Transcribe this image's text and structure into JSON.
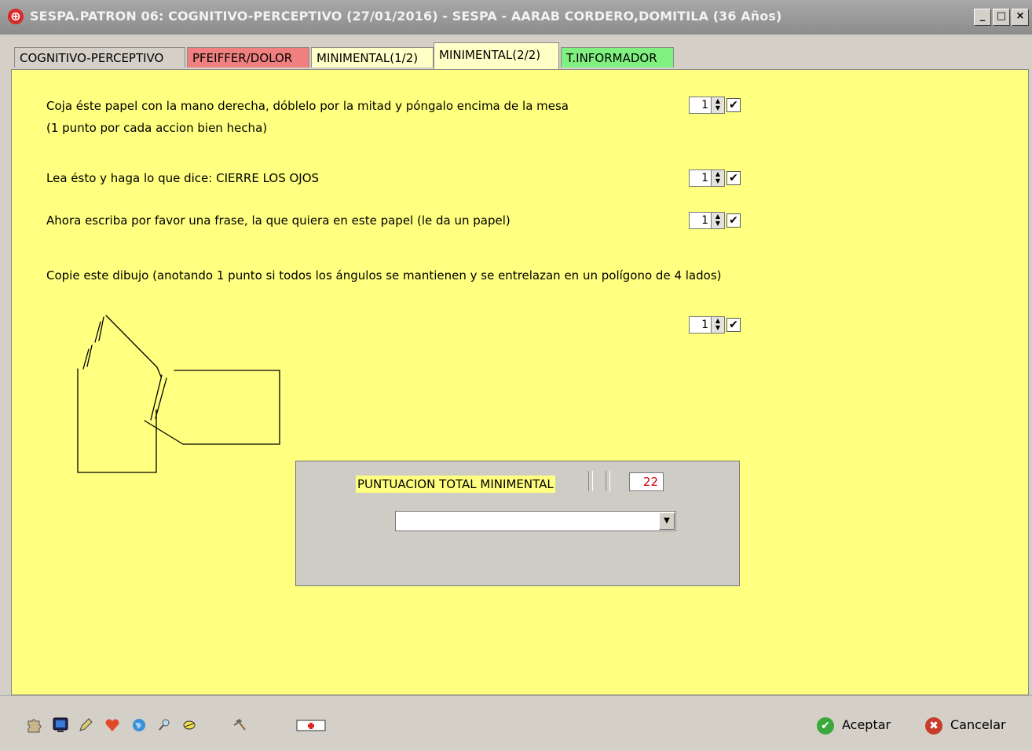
{
  "window": {
    "title": "SESPA.PATRON 06: COGNITIVO-PERCEPTIVO (27/01/2016) - SESPA - AARAB CORDERO,DOMITILA (36 Años)",
    "app_icon": "⊕",
    "min_label": "_",
    "max_label": "□",
    "close_label": "×"
  },
  "tabs": [
    {
      "label": "COGNITIVO-PERCEPTIVO",
      "color": "#d4d0c8"
    },
    {
      "label": "PFEIFFER/DOLOR",
      "color": "#f08080"
    },
    {
      "label": "MINIMENTAL(1/2)",
      "color": "#ffffc8"
    },
    {
      "label": "MINIMENTAL(2/2)",
      "color": "#ffffc8"
    },
    {
      "label": "T.INFORMADOR",
      "color": "#80f080"
    }
  ],
  "questions": [
    {
      "text": "Coja éste papel con la mano derecha, dóblelo por la mitad y póngalo encima de la mesa",
      "subtext": "(1 punto por cada accion bien hecha)",
      "value": "1",
      "checked": "✔"
    },
    {
      "text": "Lea ésto y haga lo que dice: CIERRE LOS OJOS",
      "value": "1",
      "checked": "✔"
    },
    {
      "text": "Ahora escriba por favor una frase, la que quiera en este papel (le da un papel)",
      "value": "1",
      "checked": "✔"
    },
    {
      "text": "Copie este dibujo (anotando 1 punto si todos los ángulos se mantienen   y se entrelazan en un polígono de 4 lados)",
      "value": "1",
      "checked": "✔"
    }
  ],
  "score": {
    "label": "PUNTUACION TOTAL MINIMENTAL",
    "value": "22",
    "dropdown_value": "",
    "dropdown_arrow": "▼"
  },
  "toolbar_icons": [
    "puzzle-icon",
    "monitor-icon",
    "pencil-icon",
    "heart-icon",
    "globe-icon",
    "magnifier-icon",
    "pill-icon",
    "hammer-icon",
    "medical-card-icon"
  ],
  "actions": {
    "accept_label": "Aceptar",
    "cancel_label": "Cancelar",
    "accept_glyph": "✔",
    "cancel_glyph": "✖"
  },
  "colors": {
    "panel": "#ffff80",
    "score_text": "#cc0000",
    "accept": "#3aa83a",
    "cancel": "#c83c2c"
  }
}
